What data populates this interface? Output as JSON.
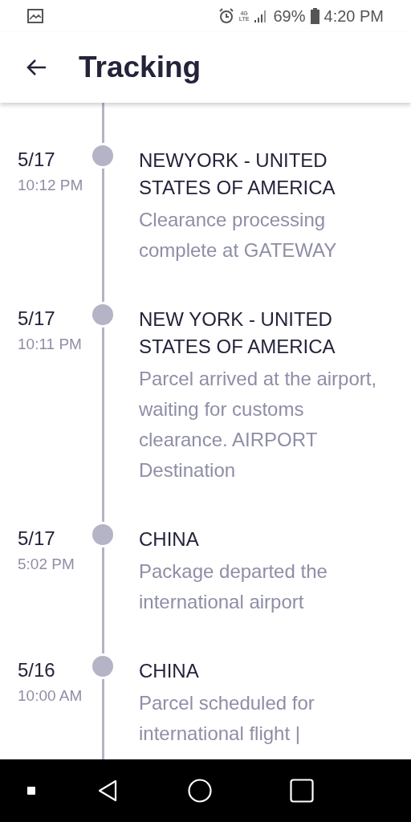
{
  "status_bar": {
    "network": [
      "4G",
      "LTE"
    ],
    "battery_text": "69%",
    "time": "4:20 PM"
  },
  "app_bar": {
    "title": "Tracking"
  },
  "events": [
    {
      "date": "5/17",
      "time": "10:12 PM",
      "location": "NEWYORK - UNITED STATES OF AMERICA",
      "description": "Clearance processing complete at GATEWAY"
    },
    {
      "date": "5/17",
      "time": "10:11 PM",
      "location": "NEW YORK - UNITED STATES OF AMERICA",
      "description": "Parcel arrived at the airport, waiting for customs clearance. AIRPORT Destination"
    },
    {
      "date": "5/17",
      "time": "5:02 PM",
      "location": "CHINA",
      "description": "Package departed the international airport"
    },
    {
      "date": "5/16",
      "time": "10:00 AM",
      "location": "CHINA",
      "description": "Parcel scheduled for international flight |"
    }
  ]
}
